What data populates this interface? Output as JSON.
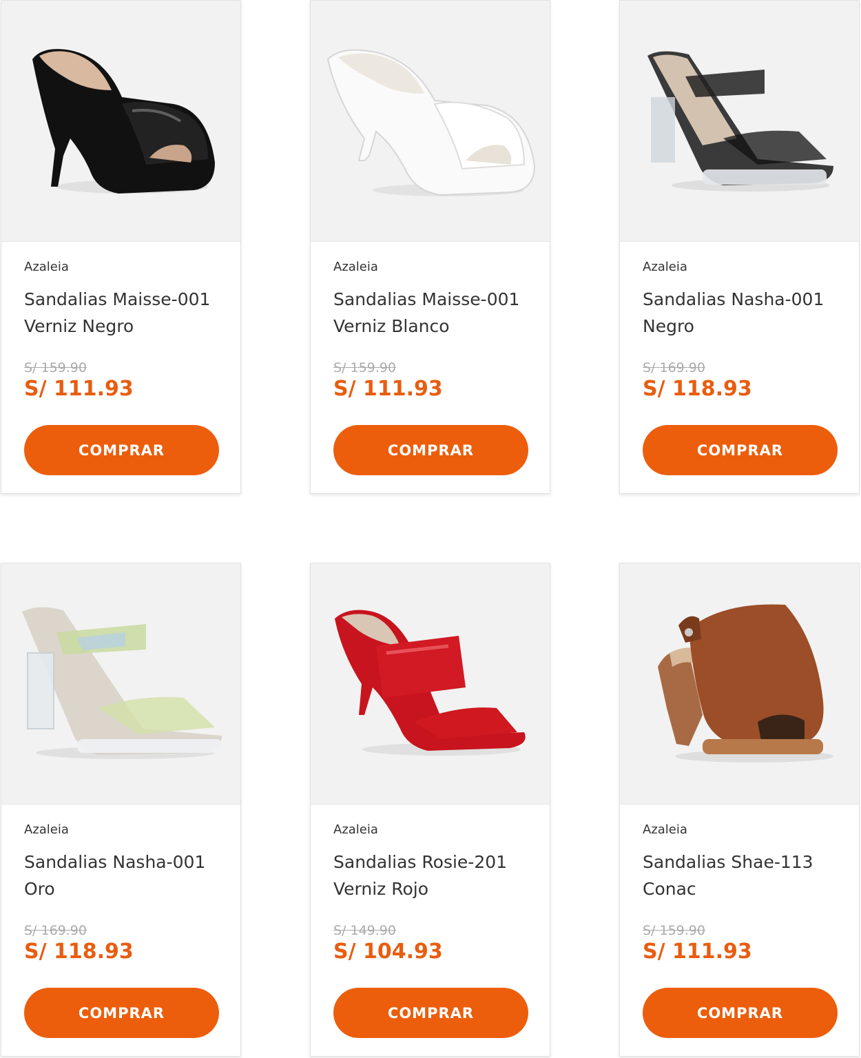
{
  "products": [
    {
      "brand": "Azaleia",
      "name": "Sandalias Maisse-001 Verniz Negro",
      "old_price": "S/ 159.90",
      "price": "S/ 111.93",
      "cta": "COMPRAR",
      "image_icon": "black-patent-mule-heel-icon"
    },
    {
      "brand": "Azaleia",
      "name": "Sandalias Maisse-001 Verniz Blanco",
      "old_price": "S/ 159.90",
      "price": "S/ 111.93",
      "cta": "COMPRAR",
      "image_icon": "white-patent-mule-heel-icon"
    },
    {
      "brand": "Azaleia",
      "name": "Sandalias Nasha-001 Negro",
      "old_price": "S/ 169.90",
      "price": "S/ 118.93",
      "cta": "COMPRAR",
      "image_icon": "black-clear-block-heel-sandal-icon"
    },
    {
      "brand": "Azaleia",
      "name": "Sandalias Nasha-001 Oro",
      "old_price": "S/ 169.90",
      "price": "S/ 118.93",
      "cta": "COMPRAR",
      "image_icon": "iridescent-clear-block-heel-sandal-icon"
    },
    {
      "brand": "Azaleia",
      "name": "Sandalias Rosie-201 Verniz Rojo",
      "old_price": "S/ 149.90",
      "price": "S/ 104.93",
      "cta": "COMPRAR",
      "image_icon": "red-patent-strappy-heel-icon"
    },
    {
      "brand": "Azaleia",
      "name": "Sandalias Shae-113 Conac",
      "old_price": "S/ 159.90",
      "price": "S/ 111.93",
      "cta": "COMPRAR",
      "image_icon": "brown-leather-peep-toe-bootie-icon"
    }
  ],
  "colors": {
    "accent": "#ec5e0c",
    "price": "#e85d10",
    "strike": "#aaaaaa",
    "text": "#333333",
    "image_bg": "#f2f2f2"
  }
}
